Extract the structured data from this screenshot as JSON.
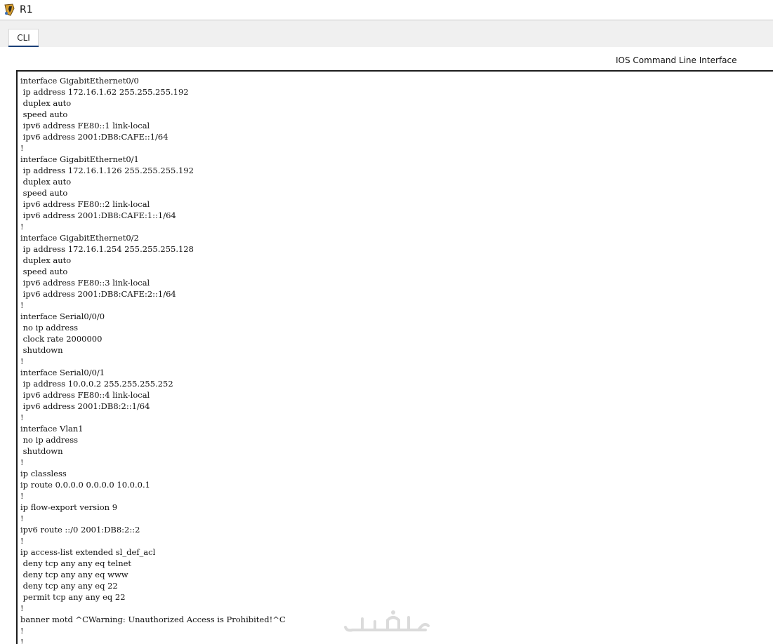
{
  "window": {
    "title": "R1",
    "icon": "router-icon"
  },
  "tabs": [
    {
      "label": "CLI",
      "active": true
    }
  ],
  "cli": {
    "header": "IOS Command Line Interface",
    "output": "interface GigabitEthernet0/0\n ip address 172.16.1.62 255.255.255.192\n duplex auto\n speed auto\n ipv6 address FE80::1 link-local\n ipv6 address 2001:DB8:CAFE::1/64\n!\ninterface GigabitEthernet0/1\n ip address 172.16.1.126 255.255.255.192\n duplex auto\n speed auto\n ipv6 address FE80::2 link-local\n ipv6 address 2001:DB8:CAFE:1::1/64\n!\ninterface GigabitEthernet0/2\n ip address 172.16.1.254 255.255.255.128\n duplex auto\n speed auto\n ipv6 address FE80::3 link-local\n ipv6 address 2001:DB8:CAFE:2::1/64\n!\ninterface Serial0/0/0\n no ip address\n clock rate 2000000\n shutdown\n!\ninterface Serial0/0/1\n ip address 10.0.0.2 255.255.255.252\n ipv6 address FE80::4 link-local\n ipv6 address 2001:DB8:2::1/64\n!\ninterface Vlan1\n no ip address\n shutdown\n!\nip classless\nip route 0.0.0.0 0.0.0.0 10.0.0.1\n!\nip flow-export version 9\n!\nipv6 route ::/0 2001:DB8:2::2\n!\nip access-list extended sl_def_acl\n deny tcp any any eq telnet\n deny tcp any any eq www\n deny tcp any any eq 22\n permit tcp any any eq 22\n!\nbanner motd ^CWarning: Unauthorized Access is Prohibited!^C\n!\n!\n!"
  },
  "colors": {
    "tab_accent": "#1a3f77",
    "terminal_border": "#1c1c1c"
  },
  "watermark": {
    "icon": "khamsat-watermark-logo",
    "text": "خمسات"
  }
}
